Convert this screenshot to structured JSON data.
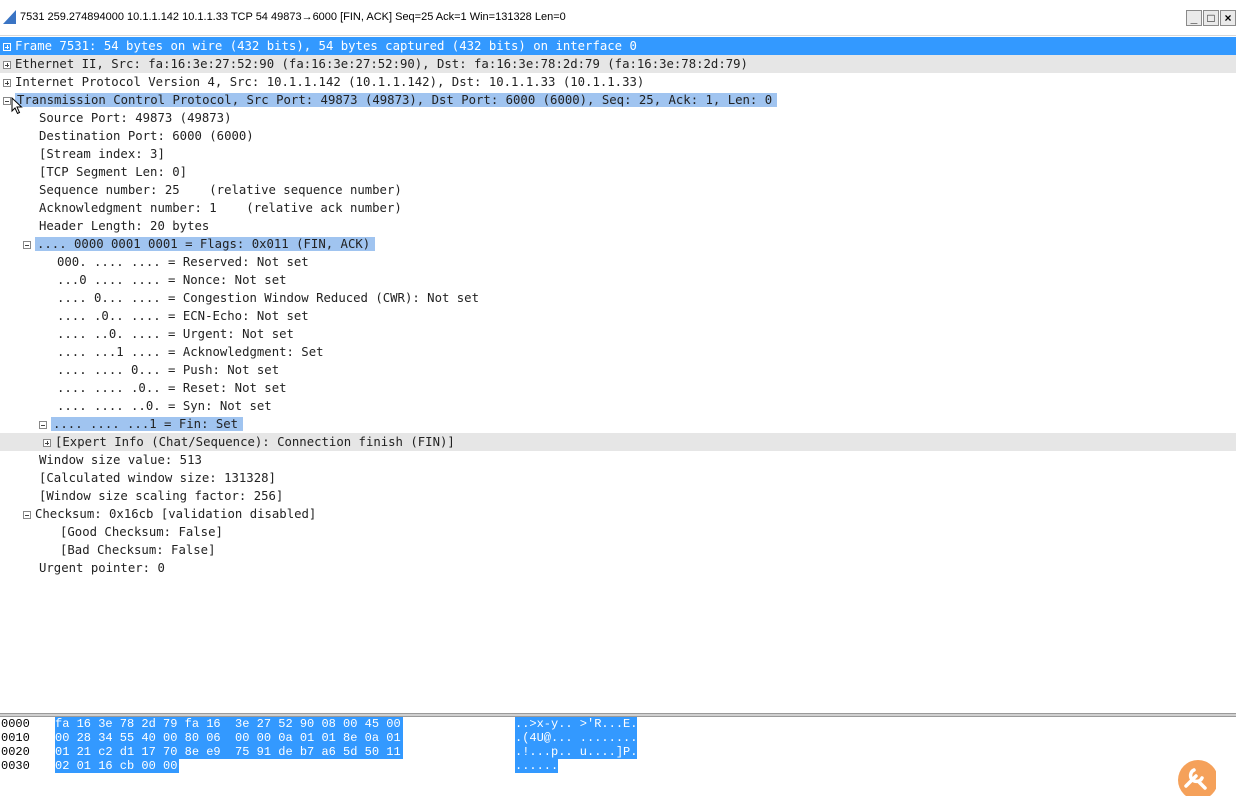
{
  "window": {
    "title": "7531 259.274894000 10.1.1.142 10.1.1.33 TCP 54 49873→6000 [FIN, ACK] Seq=25 Ack=1 Win=131328 Len=0",
    "minimize_glyph": "_",
    "maximize_glyph": "□",
    "close_glyph": "×"
  },
  "tree": {
    "frame": "Frame 7531: 54 bytes on wire (432 bits), 54 bytes captured (432 bits) on interface 0",
    "ethernet": "Ethernet II, Src: fa:16:3e:27:52:90 (fa:16:3e:27:52:90), Dst: fa:16:3e:78:2d:79 (fa:16:3e:78:2d:79)",
    "ip": "Internet Protocol Version 4, Src: 10.1.1.142 (10.1.1.142), Dst: 10.1.1.33 (10.1.1.33)",
    "tcp": "Transmission Control Protocol, Src Port: 49873 (49873), Dst Port: 6000 (6000), Seq: 25, Ack: 1, Len: 0",
    "tcp_fields": [
      "Source Port: 49873 (49873)",
      "Destination Port: 6000 (6000)",
      "[Stream index: 3]",
      "[TCP Segment Len: 0]",
      "Sequence number: 25    (relative sequence number)",
      "Acknowledgment number: 1    (relative ack number)",
      "Header Length: 20 bytes"
    ],
    "flags": ".... 0000 0001 0001 = Flags: 0x011 (FIN, ACK)",
    "flag_bits": [
      "000. .... .... = Reserved: Not set",
      "...0 .... .... = Nonce: Not set",
      ".... 0... .... = Congestion Window Reduced (CWR): Not set",
      ".... .0.. .... = ECN-Echo: Not set",
      ".... ..0. .... = Urgent: Not set",
      ".... ...1 .... = Acknowledgment: Set",
      ".... .... 0... = Push: Not set",
      ".... .... .0.. = Reset: Not set",
      ".... .... ..0. = Syn: Not set"
    ],
    "fin": ".... .... ...1 = Fin: Set",
    "expert": "[Expert Info (Chat/Sequence): Connection finish (FIN)]",
    "window_fields": [
      "Window size value: 513",
      "[Calculated window size: 131328]",
      "[Window size scaling factor: 256]"
    ],
    "checksum": "Checksum: 0x16cb [validation disabled]",
    "checksum_fields": [
      "[Good Checksum: False]",
      "[Bad Checksum: False]"
    ],
    "urgent": "Urgent pointer: 0"
  },
  "hex": [
    {
      "offset": "0000",
      "bytes": "fa 16 3e 78 2d 79 fa 16  3e 27 52 90 08 00 45 00",
      "ascii": "..>x-y.. >'R...E."
    },
    {
      "offset": "0010",
      "bytes": "00 28 34 55 40 00 80 06  00 00 0a 01 01 8e 0a 01",
      "ascii": ".(4U@... ........"
    },
    {
      "offset": "0020",
      "bytes": "01 21 c2 d1 17 70 8e e9  75 91 de b7 a6 5d 50 11",
      "ascii": ".!...p.. u....]P."
    },
    {
      "offset": "0030",
      "bytes": "02 01 16 cb 00 00",
      "ascii": "......"
    }
  ],
  "colors": {
    "selection": "#3399ff",
    "highlight_bar": "#a0c4f0",
    "tool_icon": "#f5a15a"
  }
}
